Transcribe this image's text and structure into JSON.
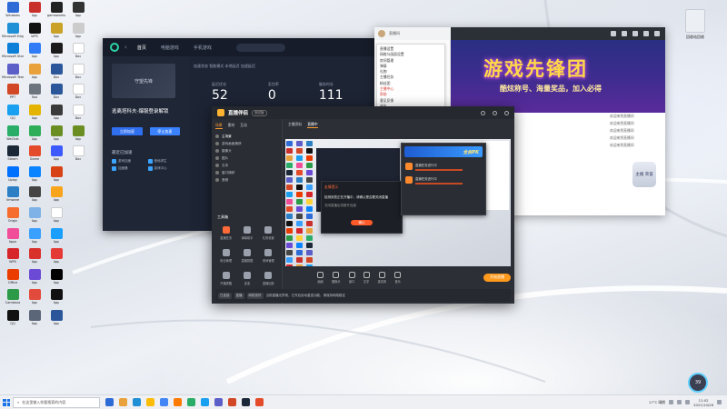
{
  "desktop": {
    "columns": [
      {
        "items": [
          {
            "label": "Windows",
            "color": "#2f6bd6"
          },
          {
            "label": "Microsoft Edge",
            "color": "#1f8fd6"
          },
          {
            "label": "Microsoft Store",
            "color": "#0c7fd9"
          },
          {
            "label": "Microsoft Teams",
            "color": "#5b5fc7"
          },
          {
            "label": "PPT",
            "color": "#d24726"
          },
          {
            "label": "QQ",
            "color": "#1aa0f0"
          },
          {
            "label": "WeChat",
            "color": "#2aae67"
          },
          {
            "label": "Steam",
            "color": "#1b2838"
          },
          {
            "label": "Uplay",
            "color": "#0070ff"
          },
          {
            "label": "Vmware",
            "color": "#2c7fc4"
          },
          {
            "label": "Origin",
            "color": "#f56c2d"
          },
          {
            "label": "Apps",
            "color": "#f04e98"
          },
          {
            "label": "WPS",
            "color": "#d6262c"
          },
          {
            "label": "Office",
            "color": "#eb3c00"
          },
          {
            "label": "Camtasia",
            "color": "#2d9a48"
          },
          {
            "label": "QQ",
            "color": "#111111"
          }
        ]
      },
      {
        "items": [
          {
            "label": "App",
            "color": "#c9302c"
          },
          {
            "label": "WPS",
            "color": "#111111"
          },
          {
            "label": "App",
            "color": "#2f7cf6"
          },
          {
            "label": "App",
            "color": "#e9a23b"
          },
          {
            "label": "Tool",
            "color": "#6c757d"
          },
          {
            "label": "App",
            "color": "#e4b400"
          },
          {
            "label": "App",
            "color": "#2fae5a"
          },
          {
            "label": "Game",
            "color": "#e34b2a"
          },
          {
            "label": "App",
            "color": "#0a84ff"
          },
          {
            "label": "App",
            "color": "#444444"
          },
          {
            "label": "App",
            "color": "#7fb3e8"
          },
          {
            "label": "App",
            "color": "#3aa0ff"
          },
          {
            "label": "App",
            "color": "#d9302c"
          },
          {
            "label": "App",
            "color": "#6b4bd6"
          },
          {
            "label": "App",
            "color": "#e24a3b"
          },
          {
            "label": "App",
            "color": "#5b6678"
          }
        ]
      },
      {
        "items": [
          {
            "label": "gameworks",
            "color": "#222222"
          },
          {
            "label": "App",
            "color": "#c9a227"
          },
          {
            "label": "App",
            "color": "#1a1a1a"
          },
          {
            "label": "Doc",
            "color": "#2b579a"
          },
          {
            "label": "Doc",
            "color": "#2b579a"
          },
          {
            "label": "App",
            "color": "#3a3a3a"
          },
          {
            "label": "App",
            "color": "#6b8e23"
          },
          {
            "label": "App",
            "color": "#3d5afe"
          },
          {
            "label": "App",
            "color": "#d84315"
          },
          {
            "label": "App",
            "color": "#f8a51c"
          },
          {
            "label": "App",
            "color": "#ffffff"
          },
          {
            "label": "App",
            "color": "#1a9fff"
          },
          {
            "label": "App",
            "color": "#e53935"
          },
          {
            "label": "App",
            "color": "#000000"
          },
          {
            "label": "App",
            "color": "#111111"
          },
          {
            "label": "App",
            "color": "#2b579a"
          }
        ]
      },
      {
        "items": [
          {
            "label": "App",
            "color": "#333333"
          },
          {
            "label": "App",
            "color": "#cccccc"
          },
          {
            "label": "Doc",
            "color": "#ffffff"
          },
          {
            "label": "Doc",
            "color": "#ffffff"
          },
          {
            "label": "Doc",
            "color": "#ffffff"
          },
          {
            "label": "Doc",
            "color": "#ffffff"
          },
          {
            "label": "App",
            "color": "#6b8e23"
          },
          {
            "label": "Doc",
            "color": "#ffffff"
          },
          {
            "label": "",
            "color": "transparent"
          },
          {
            "label": "",
            "color": "transparent"
          },
          {
            "label": "",
            "color": "transparent"
          },
          {
            "label": "",
            "color": "transparent"
          },
          {
            "label": "",
            "color": "transparent"
          },
          {
            "label": "",
            "color": "transparent"
          },
          {
            "label": "",
            "color": "transparent"
          },
          {
            "label": "",
            "color": "transparent"
          }
        ]
      }
    ],
    "top_right_icon_label": "回收站回收"
  },
  "accelerator": {
    "tabs": [
      "首页",
      "电脑游戏",
      "手机游戏"
    ],
    "banner_text": "守望先锋",
    "game_title": "逃离塔科夫-爆服登录解锁",
    "btn_primary": "立即加速",
    "btn_secondary": "停止加速",
    "recent_title": "最近已加速",
    "recent_items": [
      "游戏加速",
      "绝地求生",
      "加速器",
      "游戏中心"
    ],
    "stats_line": "加速状态  智能模式  本地延迟  加速延迟",
    "stats": [
      {
        "label": "延迟优化",
        "value": "52"
      },
      {
        "label": "丢包率",
        "value": "0"
      },
      {
        "label": "服务时长",
        "value": "111"
      }
    ]
  },
  "live_browser": {
    "title": "直播间",
    "menu_items": [
      {
        "text": "直播设置",
        "red": false
      },
      {
        "text": "网络与画面设置",
        "red": false
      },
      {
        "text": "房间管理",
        "red": false
      },
      {
        "text": "弹幕",
        "red": false
      },
      {
        "text": "礼物",
        "red": false
      },
      {
        "text": "主播任务",
        "red": false
      },
      {
        "text": "粉丝团",
        "red": false
      },
      {
        "text": "主播中心",
        "red": true
      },
      {
        "text": "帮助",
        "red": true
      },
      {
        "text": "意见反馈",
        "red": false
      },
      {
        "text": "退出",
        "red": false
      }
    ],
    "banner_title": "游戏先锋团",
    "banner_sub": "酷炫称号、海量奖品，加入必得",
    "chat_msgs": [
      "欢迎来到直播间",
      "欢迎来到直播间",
      "欢迎来到直播间",
      "欢迎来到直播间",
      "欢迎来到直播间"
    ],
    "badge_text": "主播 荣誉",
    "input_hint": "发送"
  },
  "tool": {
    "name": "直播伴侣",
    "version": "测试版",
    "left_tabs": [
      "场景",
      "素材",
      "互动"
    ],
    "scenes": [
      {
        "name": "主场景",
        "sel": true
      },
      {
        "name": "游戏画面捕获",
        "sel": false
      },
      {
        "name": "摄像头",
        "sel": false
      },
      {
        "name": "图片",
        "sel": false
      },
      {
        "name": "文本",
        "sel": false
      },
      {
        "name": "窗口捕获",
        "sel": false
      },
      {
        "name": "音频",
        "sel": false
      }
    ],
    "tools_title": "工具箱",
    "tools": [
      {
        "name": "直播任务",
        "hot": true
      },
      {
        "name": "弹幕助手",
        "hot": false
      },
      {
        "name": "礼物设置",
        "hot": false
      },
      {
        "name": "粉丝管理",
        "hot": false
      },
      {
        "name": "直播数据",
        "hot": false
      },
      {
        "name": "房间管理",
        "hot": false
      },
      {
        "name": "开播提醒",
        "hot": false
      },
      {
        "name": "连麦",
        "hot": false
      },
      {
        "name": "直播回放",
        "hot": false
      }
    ],
    "center_tabs": [
      "主播资料",
      "直播中"
    ],
    "dialog_title": "友情提示",
    "dialog_text": "检测到您正在开播中，请确认是否要关闭直播",
    "dialog_sub": "关闭直播后将断开连接",
    "dialog_btn": "确认",
    "popup_banner": "全民PK",
    "popup_items": [
      "直播任务进行中",
      "直播任务进行中"
    ],
    "bottom_buttons": [
      "画面",
      "摄像头",
      "窗口",
      "文字",
      "麦克风",
      "音乐"
    ],
    "start_label": "开始直播",
    "status_items": [
      "已连接",
      "直播",
      "网络良好"
    ],
    "status_text": "当前直播无异常，已开启自动重连功能，请保持网络稳定"
  },
  "taskbar": {
    "search_placeholder": "在这里输入你要搜索的内容",
    "apps": [
      "#2f6bd6",
      "#e9a23b",
      "#1f8fd6",
      "#fbbc05",
      "#4285f4",
      "#ff7a00",
      "#2aae67",
      "#1aa0f0",
      "#5b5fc7",
      "#d24726",
      "#1b2838",
      "#e34b2a"
    ],
    "weather": "17°C 晴朗",
    "time": "11:02",
    "date": "2021/10/26",
    "bubble": "39"
  }
}
